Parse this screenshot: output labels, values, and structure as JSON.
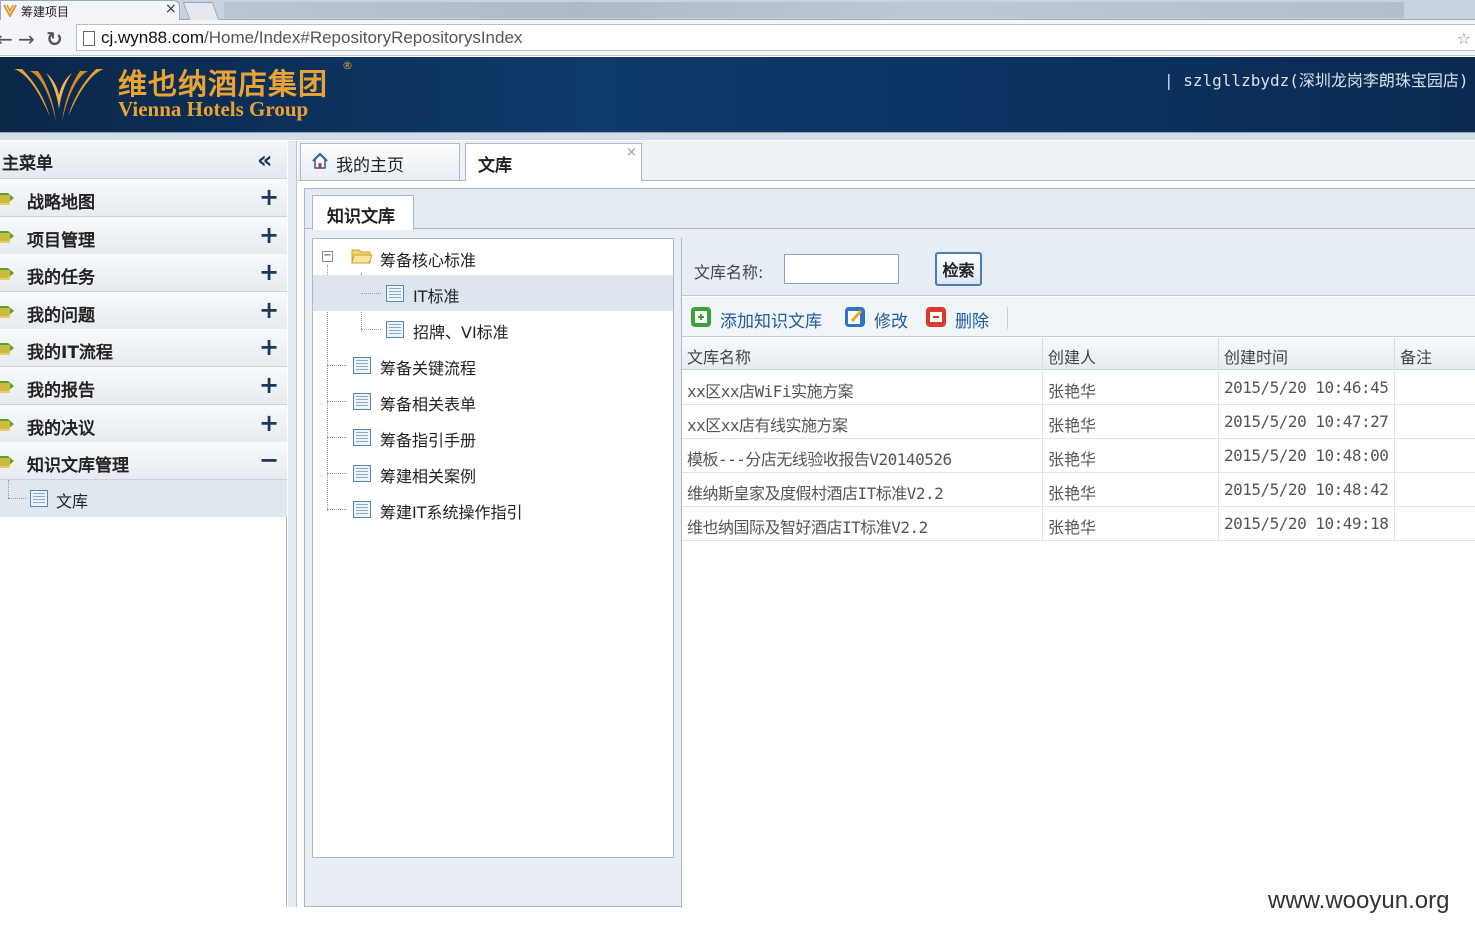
{
  "browser": {
    "tab_title": "筹建项目",
    "tab_close": "×",
    "url_domain": "cj.wyn88.com",
    "url_path": "/Home/Index#RepositoryRepositorysIndex",
    "back": "←",
    "forward": "→",
    "reload": "↻"
  },
  "header": {
    "brand_cn": "维也纳酒店集团",
    "brand_reg": "®",
    "brand_en": "Vienna Hotels Group",
    "user_info": "| szlgllzbydz(深圳龙岗李朗珠宝园店)"
  },
  "sidebar": {
    "title": "主菜单",
    "collapse": "«",
    "items": [
      {
        "label": "战略地图",
        "toggle": "+"
      },
      {
        "label": "项目管理",
        "toggle": "+"
      },
      {
        "label": "我的任务",
        "toggle": "+"
      },
      {
        "label": "我的问题",
        "toggle": "+"
      },
      {
        "label": "我的IT流程",
        "toggle": "+"
      },
      {
        "label": "我的报告",
        "toggle": "+"
      },
      {
        "label": "我的决议",
        "toggle": "+"
      },
      {
        "label": "知识文库管理",
        "toggle": "−"
      }
    ],
    "subitem": "文库"
  },
  "tabs": {
    "home": "我的主页",
    "library": "文库",
    "library_close": "×"
  },
  "subtab": "知识文库",
  "tree": {
    "root": {
      "label": "筹备核心标准",
      "expander": "−"
    },
    "children": [
      "IT标准",
      "招牌、VI标准"
    ],
    "siblings": [
      "筹备关键流程",
      "筹备相关表单",
      "筹备指引手册",
      "筹建相关案例",
      "筹建IT系统操作指引"
    ]
  },
  "search": {
    "label": "文库名称:",
    "value": "",
    "button": "检索"
  },
  "toolbar": {
    "add": "添加知识文库",
    "edit": "修改",
    "delete": "删除"
  },
  "grid": {
    "columns": [
      "文库名称",
      "创建人",
      "创建时间",
      "备注"
    ],
    "rows": [
      [
        "xx区xx店WiFi实施方案",
        "张艳华",
        "2015/5/20 10:46:45",
        ""
      ],
      [
        "xx区xx店有线实施方案",
        "张艳华",
        "2015/5/20 10:47:27",
        ""
      ],
      [
        "模板---分店无线验收报告V20140526",
        "张艳华",
        "2015/5/20 10:48:00",
        ""
      ],
      [
        "维纳斯皇家及度假村酒店IT标准V2.2",
        "张艳华",
        "2015/5/20 10:48:42",
        ""
      ],
      [
        "维也纳国际及智好酒店IT标准V2.2",
        "张艳华",
        "2015/5/20 10:49:18",
        ""
      ]
    ]
  },
  "watermark": "www.wooyun.org",
  "colors": {
    "header_bg": "#0e3a6c",
    "brand": "#e8a235",
    "link": "#1e5b9c"
  }
}
